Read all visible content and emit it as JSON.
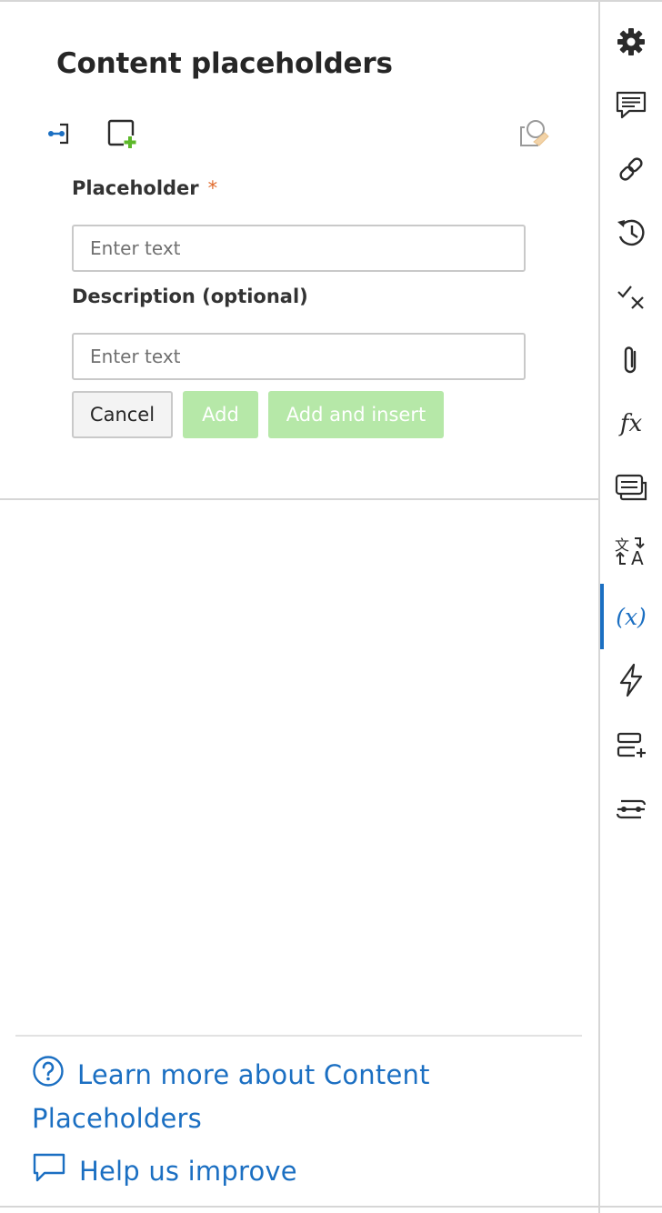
{
  "panel": {
    "title": "Content placeholders",
    "toolbar": {
      "insert_icon": "insert-placeholder-icon",
      "add_icon": "add-placeholder-icon",
      "clear_icon": "clear-placeholder-icon"
    },
    "form": {
      "placeholder_label": "Placeholder",
      "required_marker": "*",
      "placeholder_input_placeholder": "Enter text",
      "placeholder_value": "",
      "description_label": "Description (optional)",
      "description_input_placeholder": "Enter text",
      "description_value": ""
    },
    "buttons": {
      "cancel": "Cancel",
      "add": "Add",
      "add_and_insert": "Add and insert"
    }
  },
  "footer": {
    "learn_more": "Learn more about Content Placeholders",
    "help_improve": "Help us improve"
  },
  "rail": {
    "items": [
      {
        "icon": "gear-icon",
        "active": false
      },
      {
        "icon": "comments-icon",
        "active": false
      },
      {
        "icon": "link-icon",
        "active": false
      },
      {
        "icon": "history-icon",
        "active": false
      },
      {
        "icon": "check-cross-icon",
        "active": false
      },
      {
        "icon": "paperclip-icon",
        "active": false
      },
      {
        "icon": "function-icon",
        "active": false
      },
      {
        "icon": "cards-icon",
        "active": false
      },
      {
        "icon": "translate-icon",
        "active": false
      },
      {
        "icon": "variable-icon",
        "active": true
      },
      {
        "icon": "lightning-icon",
        "active": false
      },
      {
        "icon": "add-row-icon",
        "active": false
      },
      {
        "icon": "connector-icon",
        "active": false
      }
    ],
    "variable_glyph": "(x)",
    "function_glyph": "fx",
    "translate_glyph_top": "文",
    "translate_glyph_bottom": "A"
  },
  "colors": {
    "accent": "#1b6fc2",
    "required": "#e06a2c",
    "disabled_button": "#b6e8a8",
    "add_plus": "#5cb82a"
  }
}
